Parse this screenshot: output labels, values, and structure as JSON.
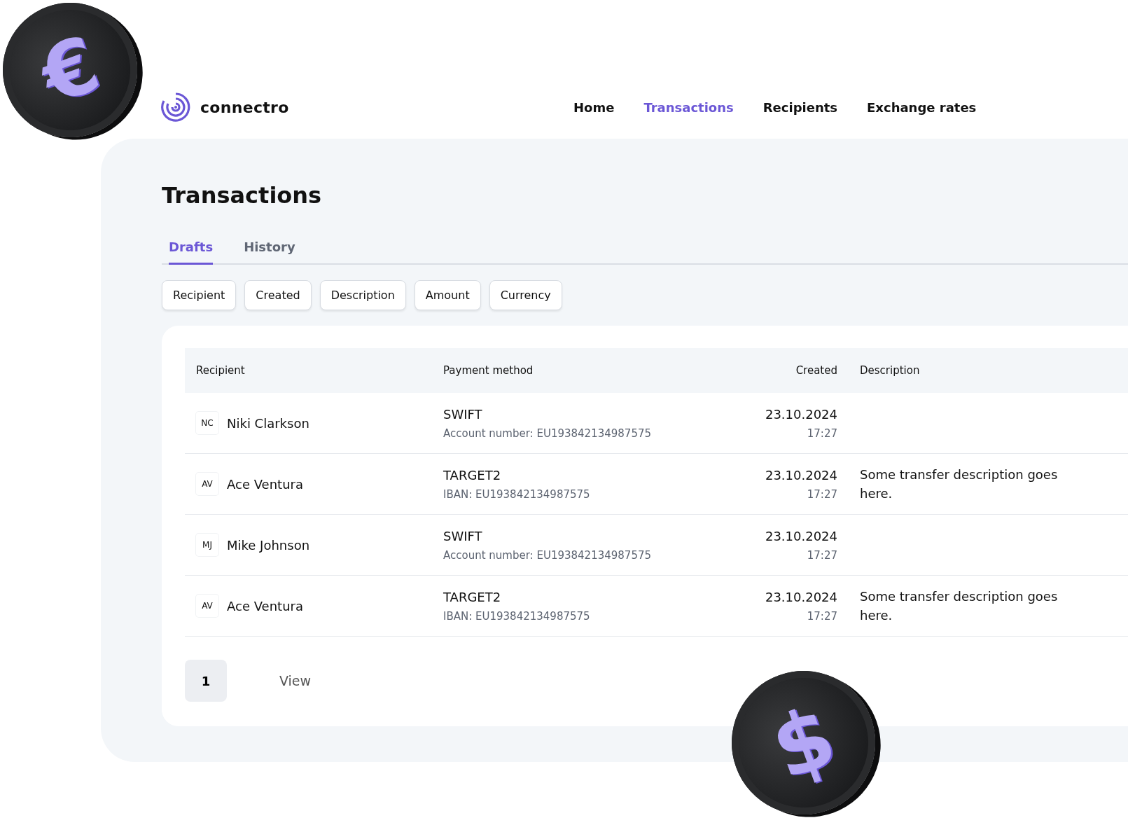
{
  "brand": {
    "name": "connectro"
  },
  "nav": [
    {
      "label": "Home",
      "selected": false
    },
    {
      "label": "Transactions",
      "selected": true
    },
    {
      "label": "Recipients",
      "selected": false
    },
    {
      "label": "Exchange rates",
      "selected": false
    }
  ],
  "page_title": "Transactions",
  "tabs": [
    {
      "label": "Drafts",
      "selected": true
    },
    {
      "label": "History",
      "selected": false
    }
  ],
  "filters": [
    "Recipient",
    "Created",
    "Description",
    "Amount",
    "Currency"
  ],
  "table": {
    "columns": [
      "Recipient",
      "Payment method",
      "Created",
      "Description"
    ],
    "rows": [
      {
        "initials": "NC",
        "recipient": "Niki Clarkson",
        "method": "SWIFT",
        "account": "Account number: EU193842134987575",
        "date": "23.10.2024",
        "time": "17:27",
        "description": ""
      },
      {
        "initials": "AV",
        "recipient": "Ace Ventura",
        "method": "TARGET2",
        "account": "IBAN: EU193842134987575",
        "date": "23.10.2024",
        "time": "17:27",
        "description": "Some transfer description goes here."
      },
      {
        "initials": "MJ",
        "recipient": "Mike Johnson",
        "method": "SWIFT",
        "account": "Account number: EU193842134987575",
        "date": "23.10.2024",
        "time": "17:27",
        "description": ""
      },
      {
        "initials": "AV",
        "recipient": "Ace Ventura",
        "method": "TARGET2",
        "account": "IBAN: EU193842134987575",
        "date": "23.10.2024",
        "time": "17:27",
        "description": "Some transfer description goes here."
      }
    ]
  },
  "pagination": [
    {
      "label": "1",
      "selected": true
    }
  ],
  "view_link": "View",
  "coins": [
    {
      "symbol": "€"
    },
    {
      "symbol": "$"
    }
  ]
}
